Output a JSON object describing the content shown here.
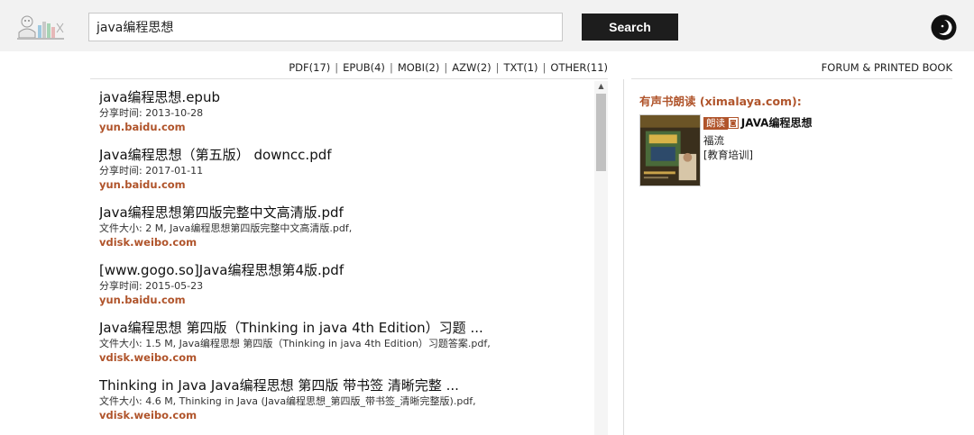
{
  "header": {
    "search_value": "java编程思想",
    "search_button": "Search"
  },
  "formats": [
    {
      "label": "PDF(17)"
    },
    {
      "label": "EPUB(4)"
    },
    {
      "label": "MOBI(2)"
    },
    {
      "label": "AZW(2)"
    },
    {
      "label": "TXT(1)"
    },
    {
      "label": "OTHER(11)"
    }
  ],
  "results": [
    {
      "title": "java编程思想.epub",
      "meta": "分享时间: 2013-10-28",
      "source": "yun.baidu.com"
    },
    {
      "title": "Java编程思想（第五版） downcc.pdf",
      "meta": "分享时间: 2017-01-11",
      "source": "yun.baidu.com"
    },
    {
      "title": "Java编程思想第四版完整中文高清版.pdf",
      "meta": "文件大小: 2 M, Java编程思想第四版完整中文高清版.pdf,",
      "source": "vdisk.weibo.com"
    },
    {
      "title": "[www.gogo.so]Java编程思想第4版.pdf",
      "meta": "分享时间: 2015-05-23",
      "source": "yun.baidu.com"
    },
    {
      "title": "Java编程思想 第四版（Thinking in java 4th Edition）习题 ...",
      "meta": "文件大小: 1.5 M, Java编程思想 第四版（Thinking in java 4th Edition）习题答案.pdf,",
      "source": "vdisk.weibo.com"
    },
    {
      "title": "Thinking in Java Java编程思想 第四版 带书签 清晰完整 ...",
      "meta": "文件大小: 4.6 M, Thinking in Java (Java编程思想_第四版_带书签_清晰完整版).pdf,",
      "source": "vdisk.weibo.com"
    }
  ],
  "sidebar": {
    "forum_link": "FORUM & PRINTED BOOK",
    "audio_heading": "有声书朗读 (ximalaya.com):",
    "book": {
      "badge": "朗读",
      "title": "JAVA编程思想",
      "author": "福流",
      "category": "[教育培训]"
    }
  },
  "colors": {
    "accent": "#b0542b",
    "header_bg": "#f2f2f2",
    "button_bg": "#1d1d1d"
  }
}
